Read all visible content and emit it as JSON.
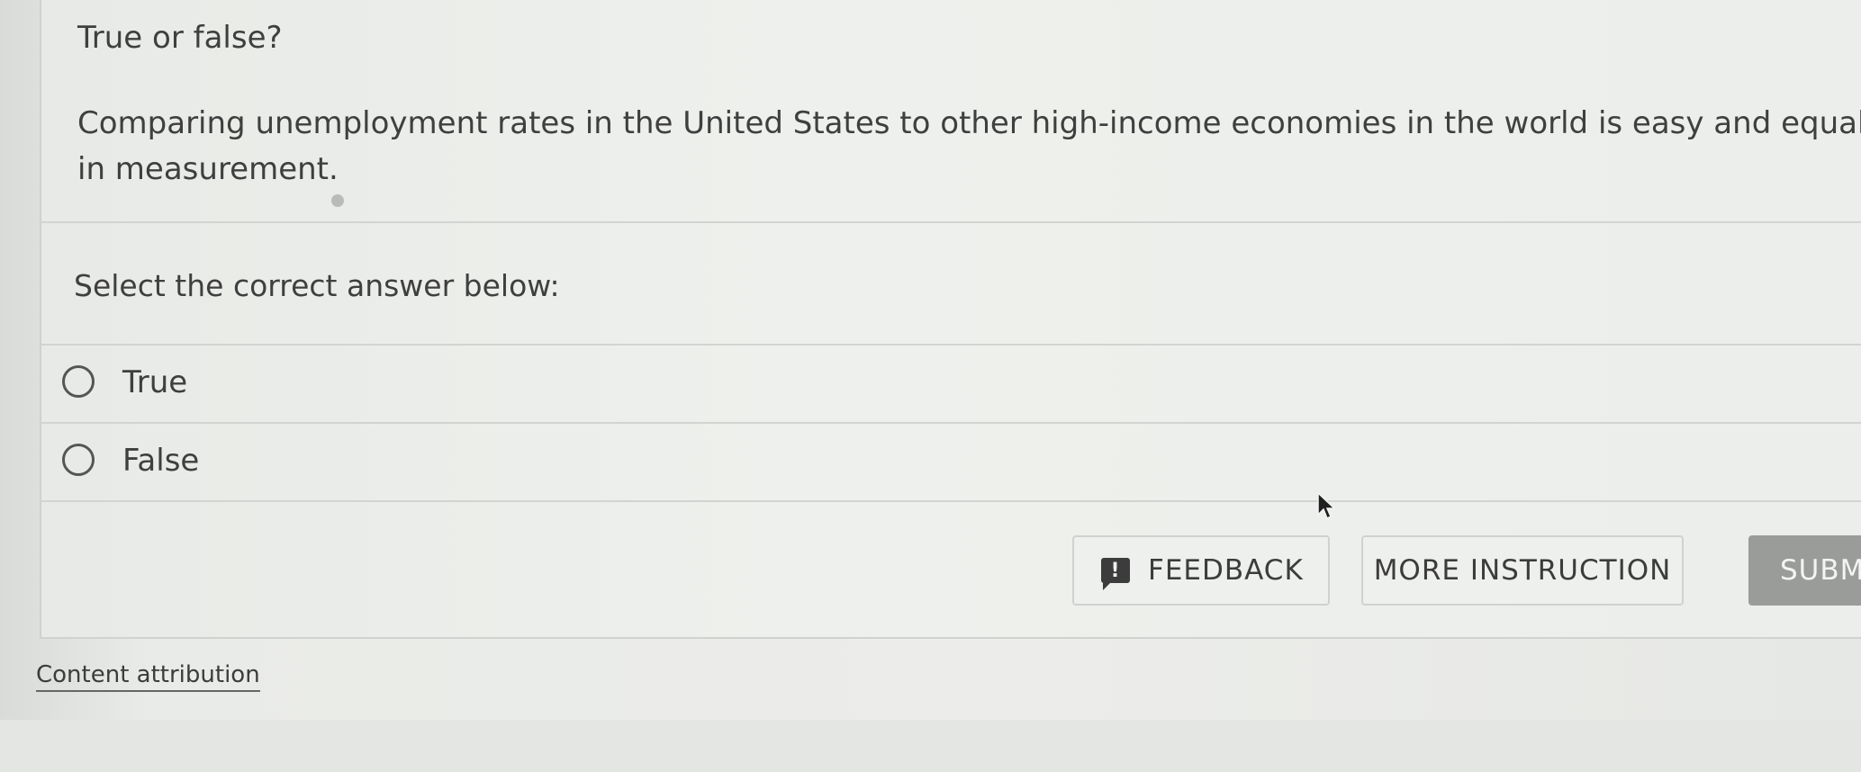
{
  "question": {
    "title": "True or false?",
    "text": "Comparing unemployment rates in the United States to other high-income economies in the world is easy and equal in measurement."
  },
  "prompt": "Select the correct answer below:",
  "options": [
    {
      "label": "True",
      "selected": false
    },
    {
      "label": "False",
      "selected": false
    }
  ],
  "buttons": {
    "feedback": "FEEDBACK",
    "more_instruction": "MORE INSTRUCTION",
    "submit": "SUBM"
  },
  "footer": {
    "attribution": "Content attribution"
  },
  "icons": {
    "feedback": "feedback-exclamation-icon",
    "cursor": "mouse-pointer-icon"
  }
}
